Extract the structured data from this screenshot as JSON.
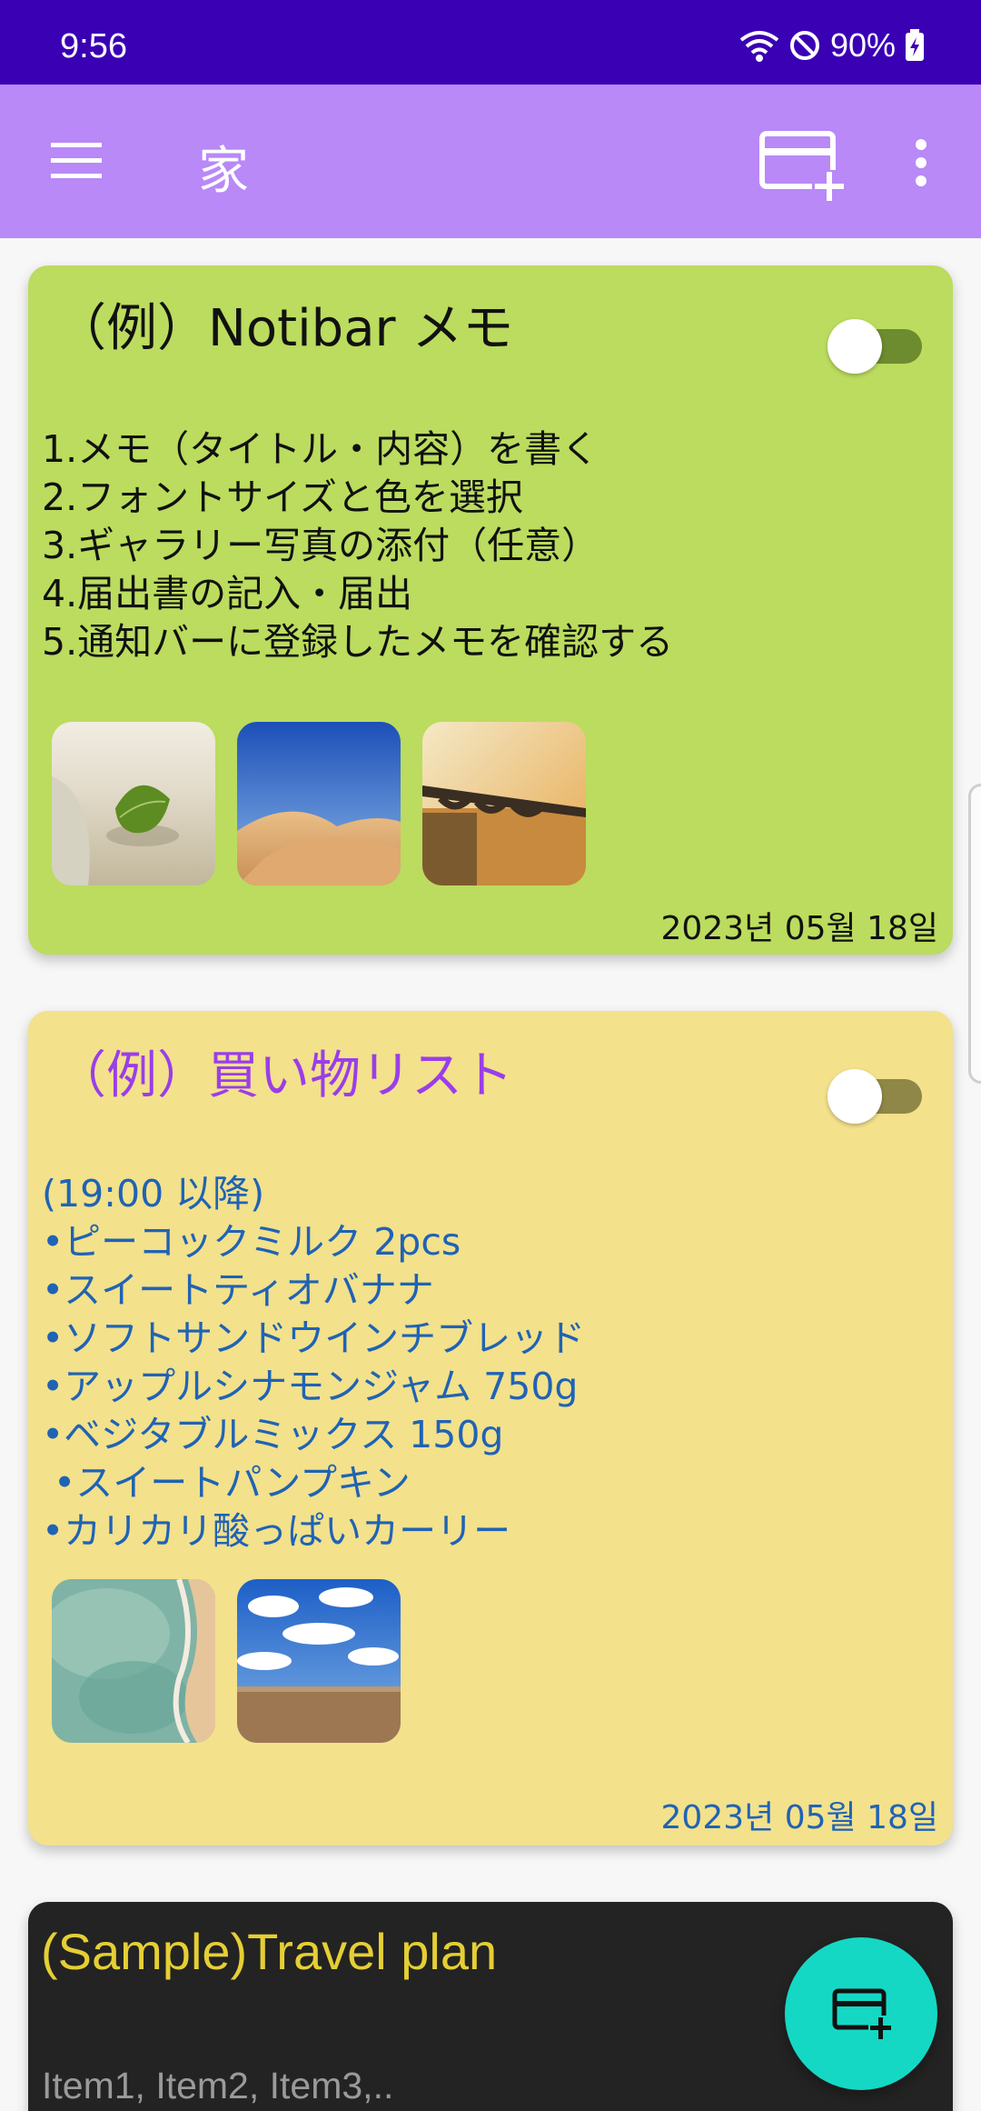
{
  "status_bar": {
    "time": "9:56",
    "battery": "90%",
    "icons": [
      "wifi-icon",
      "do-not-disturb-icon",
      "battery-charging-icon"
    ]
  },
  "app_bar": {
    "title": "家",
    "background": "#b889f7",
    "icons": [
      "menu-icon",
      "add-card-icon",
      "more-vert-icon"
    ]
  },
  "notes": [
    {
      "title": "（例）Notibar メモ",
      "lines": [
        "1.メモ（タイトル・内容）を書く",
        "2.フォントサイズと色を選択",
        "3.ギャラリー写真の添付（任意）",
        "4.届出書の記入・届出",
        "5.通知バーに登録したメモを確認する"
      ],
      "images": [
        "leaf-on-beach",
        "desert-dunes",
        "bridge-sunset"
      ],
      "date": "2023년 05월 18일",
      "toggle_on": false,
      "background": "#bbdc5e"
    },
    {
      "title": "（例）買い物リスト",
      "lines": [
        "(19:00 以降)",
        "•ピーコックミルク 2pcs",
        "•スイートティオバナナ",
        "•ソフトサンドウインチブレッド",
        "•アップルシナモンジャム 750g",
        "•ベジタブルミックス 150g",
        " •スイートパンプキン",
        "•カリカリ酸っぱいカーリー"
      ],
      "images": [
        "aerial-coast",
        "sky-field"
      ],
      "date": "2023년 05월 18일",
      "toggle_on": false,
      "background": "#f3e18b"
    },
    {
      "title": "(Sample)Travel plan",
      "lines": [
        "Item1, Item2, Item3,.."
      ],
      "background": "#232323"
    }
  ],
  "fab": {
    "icon": "add-card-icon",
    "color": "#14d8c4"
  }
}
